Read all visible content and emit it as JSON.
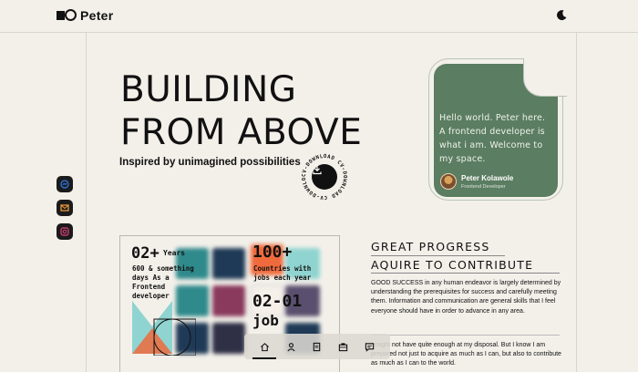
{
  "header": {
    "brand": "Peter",
    "theme_icon": "moon-icon"
  },
  "hero": {
    "title": "BUILDING FROM ABOVE",
    "subtitle": "Inspired by unimagined possibilities",
    "download_badge_text": "CV-DOWNLOAD CV-DOWNLOAD CV-DOWNLOAD"
  },
  "intro_card": {
    "text": "Hello world. Peter here. A frontend developer is what i am. Welcome to my space.",
    "name": "Peter Kolawole",
    "role": "Frontend Developer"
  },
  "social": [
    {
      "icon": "messenger-icon",
      "color": "#2f7cf6"
    },
    {
      "icon": "mail-icon",
      "color": "#f4a23c"
    },
    {
      "icon": "instagram-icon",
      "color": "#e2417d"
    }
  ],
  "experience": {
    "years_value": "02+",
    "years_unit": "Years",
    "years_desc": "600 & something days As a Frontend developer",
    "jobs_value": "100+",
    "jobs_desc": "Countries with jobs each year",
    "job_value": "02-01",
    "job_unit": "job"
  },
  "about": {
    "heading1": "GREAT PROGRESS",
    "heading2": "AQUIRE TO CONTRIBUTE",
    "paragraph1": "GOOD SUCCESS in any human endeavor is largely determined by understanding the prerequisites for success and carefully meeting them. Information and communication are general skills that I feel everyone should have in order to advance in any area.",
    "paragraph2": "I might not have quite enough at my disposal. But I know I am prepared not just to acquire as much as I can, but also to contribute as much as I can to the world."
  },
  "dock": [
    {
      "icon": "home-icon",
      "active": true
    },
    {
      "icon": "user-icon",
      "active": false
    },
    {
      "icon": "document-icon",
      "active": false
    },
    {
      "icon": "briefcase-icon",
      "active": false
    },
    {
      "icon": "message-icon",
      "active": false
    }
  ],
  "colors": {
    "background": "#f3f0ea",
    "card_green": "#5b7d61",
    "accent_orange": "#ef6a3c",
    "accent_teal": "#2f8a8c",
    "accent_navy": "#1f3a57"
  }
}
